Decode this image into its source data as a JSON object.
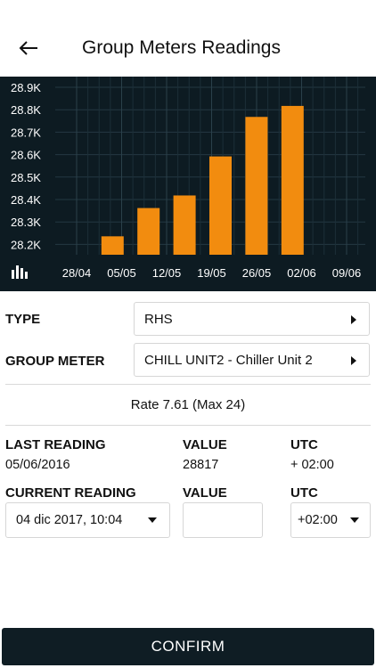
{
  "header": {
    "title": "Group Meters Readings"
  },
  "chart_data": {
    "type": "bar",
    "x_ticks": [
      "28/04",
      "05/05",
      "12/05",
      "19/05",
      "26/05",
      "02/06",
      "09/06"
    ],
    "y_ticks": [
      "28.9K",
      "28.8K",
      "28.7K",
      "28.6K",
      "28.5K",
      "28.4K",
      "28.3K",
      "28.2K"
    ],
    "ylim": [
      28150,
      28920
    ],
    "points": [
      {
        "x_index": 0.6,
        "value": 28236
      },
      {
        "x_index": 1.4,
        "value": 28362
      },
      {
        "x_index": 2.2,
        "value": 28418
      },
      {
        "x_index": 3.0,
        "value": 28592
      },
      {
        "x_index": 3.8,
        "value": 28768
      },
      {
        "x_index": 4.6,
        "value": 28817
      }
    ],
    "bar_color": "#f28c0f",
    "background": "#0d1b22",
    "grid": true
  },
  "form": {
    "type_label": "TYPE",
    "type_value": "RHS",
    "group_meter_label": "GROUP METER",
    "group_meter_value": "CHILL UNIT2 - Chiller Unit 2",
    "rate_text": "Rate 7.61 (Max 24)"
  },
  "last_reading": {
    "label": "LAST READING",
    "date": "05/06/2016",
    "value_label": "VALUE",
    "value": "28817",
    "utc_label": "UTC",
    "utc": "+ 02:00"
  },
  "current_reading": {
    "label": "CURRENT READING",
    "date": "04 dic 2017, 10:04",
    "value_label": "VALUE",
    "value": "",
    "utc_label": "UTC",
    "utc": "+02:00"
  },
  "confirm_label": "CONFIRM"
}
